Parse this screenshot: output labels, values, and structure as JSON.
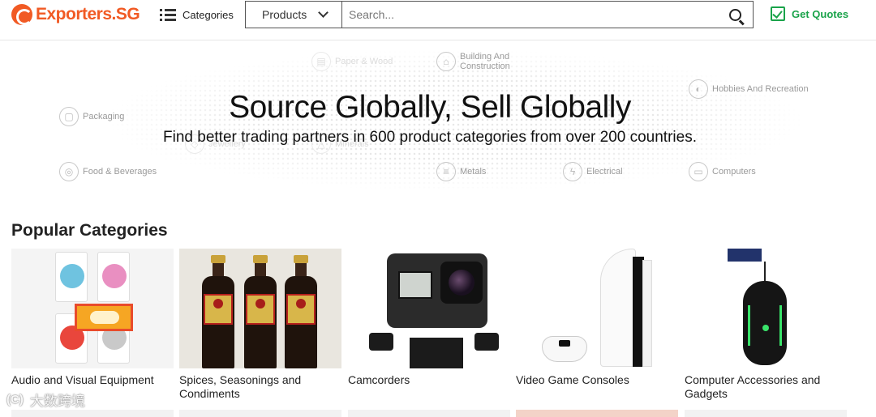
{
  "header": {
    "logo": "Exporters.SG",
    "categories_label": "Categories",
    "product_select": "Products",
    "search_placeholder": "Search...",
    "get_quotes_label": "Get Quotes",
    "accent_color": "#f15a24",
    "quote_color": "#1aa34a"
  },
  "hero": {
    "title": "Source Globally, Sell Globally",
    "subtitle": "Find better trading partners in 600 product categories from over 200 countries.",
    "categories": [
      {
        "label": "Packaging",
        "icon": "package-icon"
      },
      {
        "label": "Food & Beverages",
        "icon": "food-icon"
      },
      {
        "label": "Building And Construction",
        "icon": "building-icon"
      },
      {
        "label": "Hobbies And Recreation",
        "icon": "hobby-icon"
      },
      {
        "label": "Metals",
        "icon": "metal-icon"
      },
      {
        "label": "Electrical",
        "icon": "plug-icon"
      },
      {
        "label": "Computers",
        "icon": "computer-icon"
      },
      {
        "label": "Paper & Wood",
        "icon": "paper-icon"
      },
      {
        "label": "Jewellery",
        "icon": "jewel-icon"
      },
      {
        "label": "Minerals",
        "icon": "mineral-icon"
      }
    ]
  },
  "popular": {
    "title": "Popular Categories",
    "items": [
      {
        "label": "Audio and Visual Equipment"
      },
      {
        "label": "Spices, Seasonings and Condiments"
      },
      {
        "label": "Camcorders"
      },
      {
        "label": "Video Game Consoles"
      },
      {
        "label": "Computer Accessories and Gadgets"
      }
    ]
  },
  "watermark": {
    "text": "大数跨境",
    "icon_text": "(C)"
  }
}
